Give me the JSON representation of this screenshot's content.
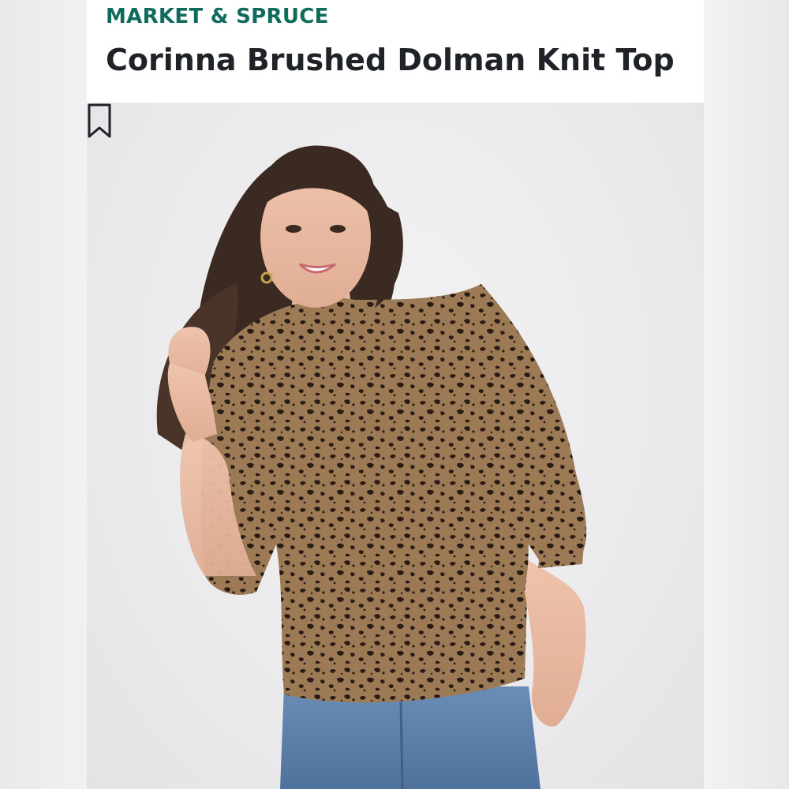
{
  "product": {
    "brand": "MARKET & SPRUCE",
    "title": "Corinna Brushed Dolman Knit Top"
  },
  "image": {
    "bookmark_icon": "bookmark-icon",
    "pattern": "leopard"
  },
  "colors": {
    "brand": "#0f6b5c",
    "title": "#1f2328",
    "top_base": "#9c7a55",
    "spots": "#2a1c14",
    "denim": "#5a7ea8",
    "hair": "#3b2a22",
    "skin": "#e8b8a0"
  }
}
